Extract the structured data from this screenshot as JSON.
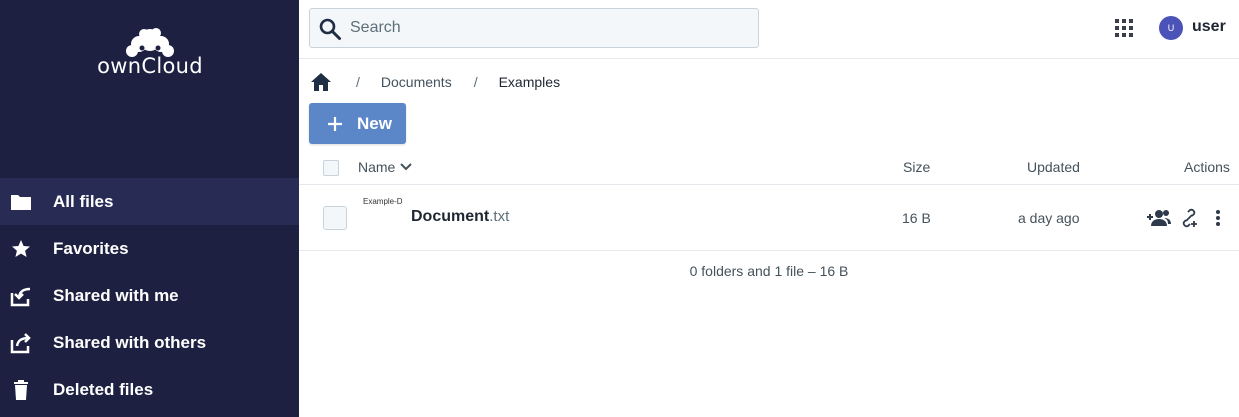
{
  "sidebar": {
    "logo_text": "ownCloud",
    "items": [
      {
        "label": "All files",
        "icon": "folder-icon",
        "active": true
      },
      {
        "label": "Favorites",
        "icon": "star-icon",
        "active": false
      },
      {
        "label": "Shared with me",
        "icon": "shared-with-me-icon",
        "active": false
      },
      {
        "label": "Shared with others",
        "icon": "shared-with-others-icon",
        "active": false
      },
      {
        "label": "Deleted files",
        "icon": "trash-icon",
        "active": false
      }
    ]
  },
  "topbar": {
    "search_placeholder": "Search",
    "user": {
      "initial": "U",
      "name": "user"
    }
  },
  "breadcrumb": {
    "separator": "/",
    "items": [
      "Documents",
      "Examples"
    ]
  },
  "new_button": {
    "label": "New"
  },
  "table": {
    "columns": {
      "name": "Name",
      "size": "Size",
      "updated": "Updated",
      "actions": "Actions"
    },
    "rows": [
      {
        "thumb_text": "Example-D",
        "name_base": "Document",
        "name_ext": ".txt",
        "size": "16 B",
        "updated": "a day ago"
      }
    ],
    "summary": "0 folders and 1 file – 16 B"
  },
  "colors": {
    "sidebar_bg": "#1d2040",
    "sidebar_active": "#282c55",
    "primary": "#5b87c9",
    "avatar": "#4b52b8"
  }
}
